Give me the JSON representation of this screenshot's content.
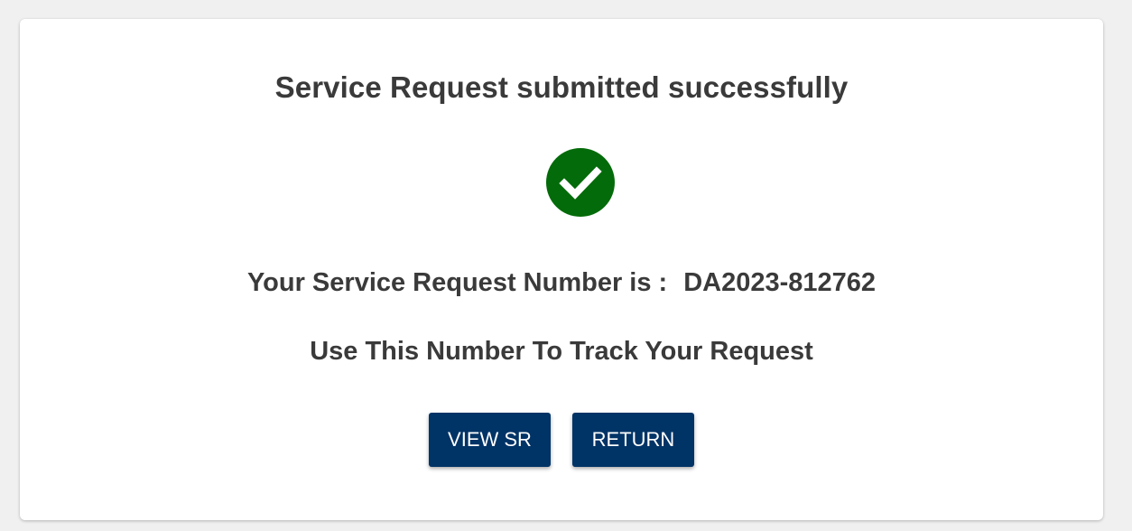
{
  "dialog": {
    "title": "Service Request submitted successfully",
    "success_icon": "check-circle-icon",
    "success_color": "#036b09",
    "sr_label": "Your Service Request Number is :",
    "sr_number": "DA2023-812762",
    "track_message": "Use This Number To Track Your Request",
    "buttons": {
      "view_sr": "VIEW SR",
      "return": "RETURN"
    },
    "button_color": "#003366"
  }
}
